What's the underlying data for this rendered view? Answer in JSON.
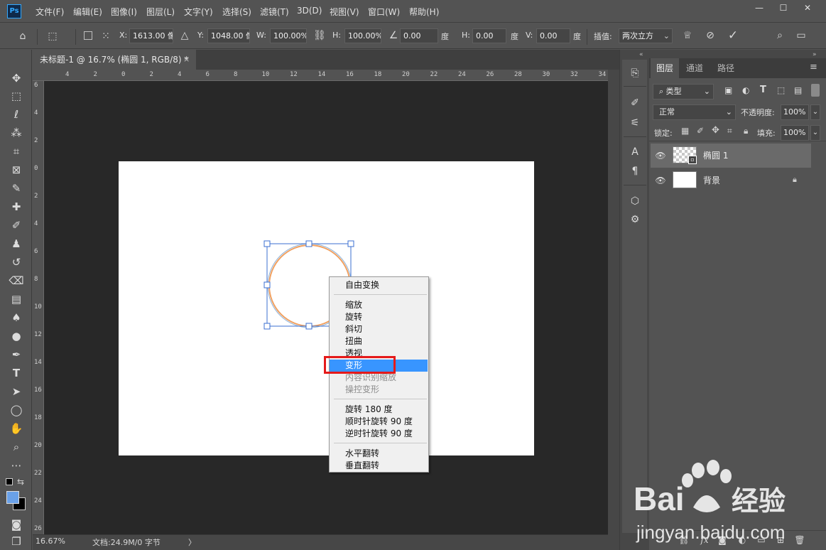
{
  "app": {
    "logo": "Ps",
    "menu": [
      "文件(F)",
      "编辑(E)",
      "图像(I)",
      "图层(L)",
      "文字(Y)",
      "选择(S)",
      "滤镜(T)",
      "3D(D)",
      "视图(V)",
      "窗口(W)",
      "帮助(H)"
    ],
    "window_buttons": [
      "minimize-icon",
      "maximize-icon",
      "close-icon"
    ]
  },
  "options_bar": {
    "x_label": "X:",
    "x_value": "1613.00 像",
    "y_label": "Y:",
    "y_value": "1048.00 像",
    "w_label": "W:",
    "w_value": "100.00%",
    "h_label": "H:",
    "h_value": "100.00%",
    "angle_value": "0.00",
    "angle_unit": "度",
    "hskew_label": "H:",
    "hskew_value": "0.00",
    "hskew_unit": "度",
    "vskew_label": "V:",
    "vskew_value": "0.00",
    "vskew_unit": "度",
    "interp_label": "插值:",
    "interp_value": "两次立方"
  },
  "document": {
    "tab_title": "未标题-1 @ 16.7% (椭圆 1, RGB/8) *",
    "close_glyph": "×",
    "ruler_top": [
      "4",
      "2",
      "0",
      "2",
      "4",
      "6",
      "8",
      "10",
      "12",
      "14",
      "16",
      "18",
      "20",
      "22",
      "24",
      "26",
      "28",
      "30",
      "32",
      "34"
    ],
    "ruler_left": [
      "6",
      "4",
      "2",
      "0",
      "2",
      "4",
      "6",
      "8",
      "10",
      "12",
      "14",
      "16",
      "18",
      "20",
      "22",
      "24",
      "26"
    ],
    "zoom": "16.67%",
    "doc_info": "文档:24.9M/0 字节",
    "status_arrow": "〉"
  },
  "context_menu": {
    "items": [
      {
        "label": "自由变换",
        "state": "normal"
      },
      {
        "label": "缩放",
        "state": "normal"
      },
      {
        "label": "旋转",
        "state": "normal"
      },
      {
        "label": "斜切",
        "state": "normal"
      },
      {
        "label": "扭曲",
        "state": "normal"
      },
      {
        "label": "透视",
        "state": "normal"
      },
      {
        "label": "变形",
        "state": "selected"
      },
      {
        "label": "内容识别缩放",
        "state": "disabled"
      },
      {
        "label": "操控变形",
        "state": "disabled"
      },
      {
        "label": "旋转 180 度",
        "state": "normal"
      },
      {
        "label": "顺时针旋转 90 度",
        "state": "normal"
      },
      {
        "label": "逆时针旋转 90 度",
        "state": "normal"
      },
      {
        "label": "水平翻转",
        "state": "normal"
      },
      {
        "label": "垂直翻转",
        "state": "normal"
      }
    ],
    "highlight_color": "#e51a1a",
    "selected_color": "#3895ff"
  },
  "layers_panel": {
    "tabs": [
      "图层",
      "通道",
      "路径"
    ],
    "filter_type": "类型",
    "blend_mode": "正常",
    "opacity_label": "不透明度:",
    "opacity_value": "100%",
    "lock_label": "锁定:",
    "fill_label": "填充:",
    "fill_value": "100%",
    "layers": [
      {
        "name": "椭圆 1",
        "selected": true,
        "transparent": true
      },
      {
        "name": "背景",
        "selected": false,
        "transparent": false,
        "locked": true
      }
    ]
  },
  "watermark": {
    "brand": "Bai",
    "brand_suffix": "经验",
    "url": "jingyan.baidu.com"
  },
  "colors": {
    "ui_bg": "#535353",
    "workspace": "#282828",
    "foreground": "#6aa1e8",
    "background": "#000000",
    "ellipse_stroke": "#f0a060",
    "transform_box": "#3b6fd0"
  }
}
